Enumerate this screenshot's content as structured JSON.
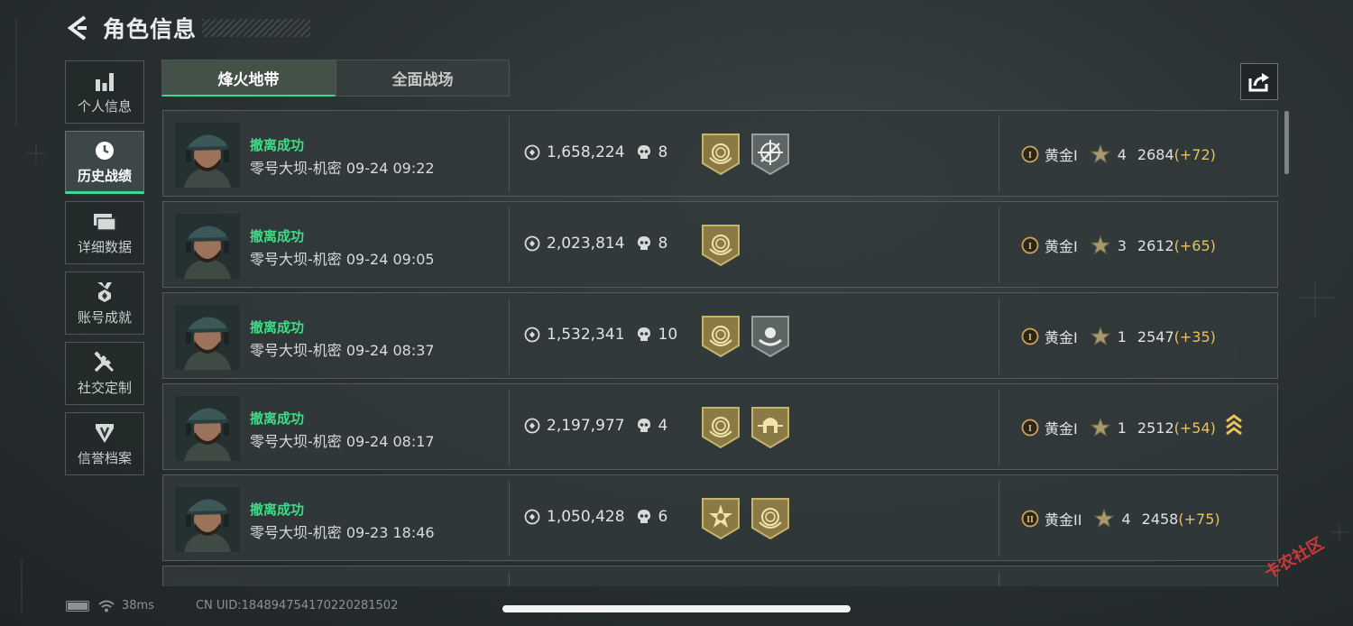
{
  "page": {
    "title": "角色信息"
  },
  "sidebar": {
    "items": [
      {
        "label": "个人信息",
        "icon": "bar-chart-icon",
        "active": false
      },
      {
        "label": "历史战绩",
        "icon": "clock-icon",
        "active": true
      },
      {
        "label": "详细数据",
        "icon": "cards-icon",
        "active": false
      },
      {
        "label": "账号成就",
        "icon": "badge-icon",
        "active": false
      },
      {
        "label": "社交定制",
        "icon": "tools-icon",
        "active": false
      },
      {
        "label": "信誉档案",
        "icon": "shield-icon",
        "active": false
      }
    ]
  },
  "tabs": [
    {
      "label": "烽火地带",
      "active": true
    },
    {
      "label": "全面战场",
      "active": false
    }
  ],
  "matches": [
    {
      "status": "撤离成功",
      "map": "零号大坝-机密",
      "time": "09-24 09:22",
      "value": "1,658,224",
      "kills": "8",
      "medals": [
        "gold-emblem-medal",
        "silver-crosshair-medal"
      ],
      "rank_icon": "I",
      "rank": "黄金I",
      "stars": "4",
      "score": "2684",
      "delta": "(+72)",
      "promo": false
    },
    {
      "status": "撤离成功",
      "map": "零号大坝-机密",
      "time": "09-24 09:05",
      "value": "2,023,814",
      "kills": "8",
      "medals": [
        "gold-emblem-medal"
      ],
      "rank_icon": "I",
      "rank": "黄金I",
      "stars": "3",
      "score": "2612",
      "delta": "(+65)",
      "promo": false
    },
    {
      "status": "撤离成功",
      "map": "零号大坝-机密",
      "time": "09-24 08:37",
      "value": "1,532,341",
      "kills": "10",
      "medals": [
        "gold-emblem-medal",
        "silver-hand-medal"
      ],
      "rank_icon": "I",
      "rank": "黄金I",
      "stars": "1",
      "score": "2547",
      "delta": "(+35)",
      "promo": false
    },
    {
      "status": "撤离成功",
      "map": "零号大坝-机密",
      "time": "09-24 08:17",
      "value": "2,197,977",
      "kills": "4",
      "medals": [
        "gold-emblem-medal",
        "gold-helmet-medal"
      ],
      "rank_icon": "I",
      "rank": "黄金I",
      "stars": "1",
      "score": "2512",
      "delta": "(+54)",
      "promo": true
    },
    {
      "status": "撤离成功",
      "map": "零号大坝-机密",
      "time": "09-23 18:46",
      "value": "1,050,428",
      "kills": "6",
      "medals": [
        "gold-star-medal",
        "gold-emblem-medal"
      ],
      "rank_icon": "II",
      "rank": "黄金II",
      "stars": "4",
      "score": "2458",
      "delta": "(+75)",
      "promo": false
    }
  ],
  "footer": {
    "ping": "38ms",
    "uid": "CN UID:184894754170220281502"
  },
  "watermark": "卡农社区",
  "colors": {
    "accent_green": "#3fdc86",
    "gold_delta": "#e8c35a",
    "medal_gold": "#8a7a45",
    "medal_silver": "#5d6664"
  }
}
